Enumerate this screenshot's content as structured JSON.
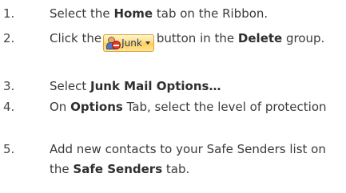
{
  "steps": [
    {
      "number": "1.",
      "parts": [
        {
          "text": "Select the ",
          "bold": false
        },
        {
          "text": "Home",
          "bold": true
        },
        {
          "text": " tab on the Ribbon.",
          "bold": false
        }
      ]
    },
    {
      "number": "2.",
      "parts": [
        {
          "text": "Click the",
          "bold": false
        },
        {
          "button": true
        },
        {
          "text": "button in the ",
          "bold": false
        },
        {
          "text": "Delete",
          "bold": true
        },
        {
          "text": " group.",
          "bold": false
        }
      ]
    },
    {
      "number": "3.",
      "parts": [
        {
          "text": "Select ",
          "bold": false
        },
        {
          "text": "Junk Mail Options…",
          "bold": true
        }
      ]
    },
    {
      "number": "4.",
      "parts": [
        {
          "text": "On ",
          "bold": false
        },
        {
          "text": "Options",
          "bold": true
        },
        {
          "text": " Tab, select the level of protection",
          "bold": false
        }
      ]
    },
    {
      "number": "5.",
      "parts": [
        {
          "text": "Add new contacts to your Safe Senders list on the ",
          "bold": false
        },
        {
          "text": "Safe Senders",
          "bold": true
        },
        {
          "text": " tab.",
          "bold": false
        }
      ]
    }
  ],
  "junk_button": {
    "label": "Junk",
    "icon": "junk-person-block-icon",
    "dropdown_icon": "chevron-down-icon"
  },
  "colors": {
    "text": "#3a3a3a",
    "button_fill": "#ffe08a",
    "button_border": "#d9a13b",
    "button_text": "#1f3a70"
  }
}
